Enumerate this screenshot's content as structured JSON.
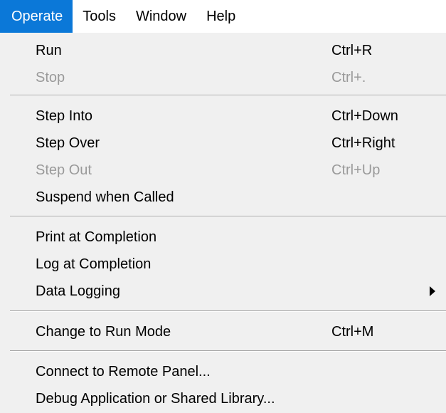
{
  "menubar": {
    "items": [
      {
        "label": "Operate"
      },
      {
        "label": "Tools"
      },
      {
        "label": "Window"
      },
      {
        "label": "Help"
      }
    ]
  },
  "operate_menu": {
    "items": [
      {
        "label": "Run",
        "shortcut": "Ctrl+R",
        "enabled": true
      },
      {
        "label": "Stop",
        "shortcut": "Ctrl+.",
        "enabled": false
      },
      {
        "label": "Step Into",
        "shortcut": "Ctrl+Down",
        "enabled": true
      },
      {
        "label": "Step Over",
        "shortcut": "Ctrl+Right",
        "enabled": true
      },
      {
        "label": "Step Out",
        "shortcut": "Ctrl+Up",
        "enabled": false
      },
      {
        "label": "Suspend when Called",
        "shortcut": "",
        "enabled": true
      },
      {
        "label": "Print at Completion",
        "shortcut": "",
        "enabled": true
      },
      {
        "label": "Log at Completion",
        "shortcut": "",
        "enabled": true
      },
      {
        "label": "Data Logging",
        "shortcut": "",
        "enabled": true,
        "has_submenu": true
      },
      {
        "label": "Change to Run Mode",
        "shortcut": "Ctrl+M",
        "enabled": true
      },
      {
        "label": "Connect to Remote Panel...",
        "shortcut": "",
        "enabled": true
      },
      {
        "label": "Debug Application or Shared Library...",
        "shortcut": "",
        "enabled": true
      }
    ]
  },
  "icons": {
    "submenu_arrow": "triangle-right-icon"
  },
  "colors": {
    "menubar_background": "#ffffff",
    "active_menu_highlight": "#0b78d8",
    "active_menu_text": "#ffffff",
    "menu_background": "#f0f0f0",
    "disabled_text": "#9a9a9a",
    "separator": "#a0a0a0"
  }
}
